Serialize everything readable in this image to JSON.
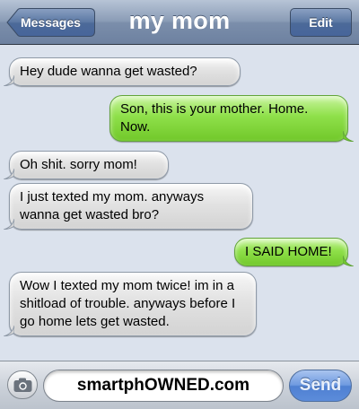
{
  "navbar": {
    "back_label": "Messages",
    "title": "my mom",
    "edit_label": "Edit"
  },
  "messages": [
    {
      "side": "in",
      "text": "Hey dude wanna get wasted?"
    },
    {
      "side": "out",
      "text": "Son, this is your mother. Home. Now."
    },
    {
      "side": "in",
      "text": "Oh shit. sorry mom!"
    },
    {
      "side": "in",
      "text": "I just texted my mom. anyways wanna get wasted bro?"
    },
    {
      "side": "out",
      "text": "I SAID HOME!"
    },
    {
      "side": "in",
      "text": "Wow I texted my mom twice! im in a shitload of trouble. anyways before I go home lets get wasted."
    }
  ],
  "input_bar": {
    "field_text": "smartphOWNED.com",
    "send_label": "Send",
    "camera_icon": "camera-icon"
  },
  "colors": {
    "incoming_bubble": "#e2e2e2",
    "outgoing_bubble": "#8fe04a",
    "background": "#dbe2ed",
    "nav_bar": "#7b8eab"
  }
}
